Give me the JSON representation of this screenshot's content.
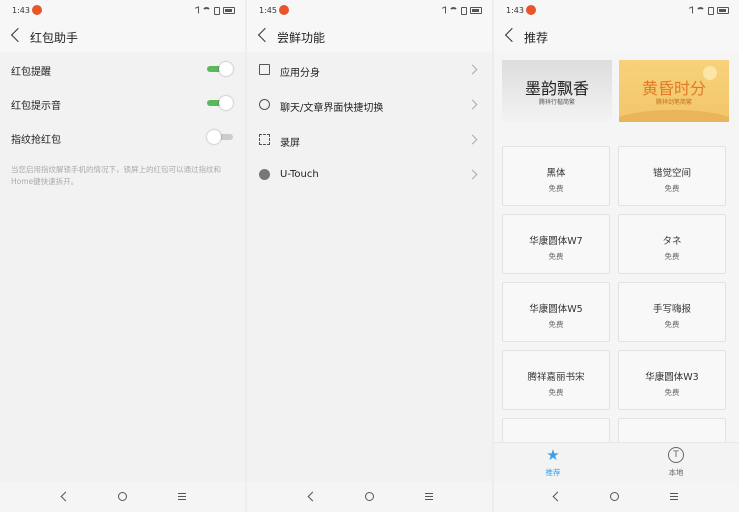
{
  "panel1": {
    "status_time": "1:43",
    "title": "红包助手",
    "rows": [
      {
        "label": "红包提醒",
        "on": true
      },
      {
        "label": "红包提示音",
        "on": true
      },
      {
        "label": "指纹抢红包",
        "on": false
      }
    ],
    "hint": "当您启用指纹解锁手机的情况下，锁屏上的红包可以通过指纹和Home键快速拆开。"
  },
  "panel2": {
    "status_time": "1:45",
    "title": "尝鲜功能",
    "rows": [
      {
        "label": "应用分身",
        "icon": "app-split-icon"
      },
      {
        "label": "聊天/文章界面快捷切换",
        "icon": "chat-switch-icon"
      },
      {
        "label": "录屏",
        "icon": "screen-record-icon"
      },
      {
        "label": "U-Touch",
        "icon": "u-touch-icon"
      }
    ]
  },
  "panel3": {
    "status_time": "1:43",
    "title": "推荐",
    "banners": [
      {
        "title": "墨韵飘香",
        "subtitle": "腾祥行楷简繁"
      },
      {
        "title": "黄昏时分",
        "subtitle": "腾祥剑笔简繁"
      }
    ],
    "fonts": [
      {
        "name": "黑体",
        "price": "免费"
      },
      {
        "name": "错觉空间",
        "price": "免费"
      },
      {
        "name": "华康圆体W7",
        "price": "免费"
      },
      {
        "name": "タネ",
        "price": "免费"
      },
      {
        "name": "华康圆体W5",
        "price": "免费"
      },
      {
        "name": "手写嗨报",
        "price": "免费"
      },
      {
        "name": "腾祥嘉丽书宋",
        "price": "免费"
      },
      {
        "name": "华康圆体W3",
        "price": "免费"
      }
    ],
    "tabs": [
      {
        "label": "推荐",
        "icon": "star-icon",
        "glyph": "★",
        "active": true
      },
      {
        "label": "本地",
        "icon": "font-icon",
        "glyph": "T",
        "active": false
      }
    ]
  },
  "colors": {
    "accent_green": "#5cb85c",
    "accent_blue": "#3aa0e8",
    "notification_badge": "#e8542b"
  }
}
